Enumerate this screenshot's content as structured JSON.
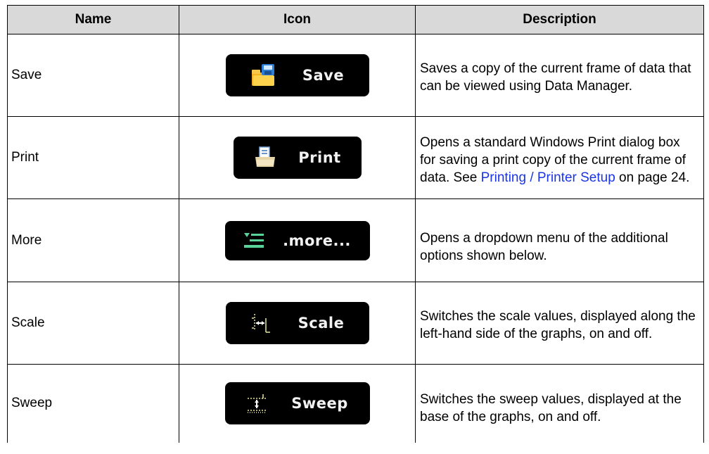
{
  "header": {
    "name": "Name",
    "icon": "Icon",
    "description": "Description"
  },
  "rows": [
    {
      "name": "Save",
      "button_label": "Save",
      "icon": "folder-disk-icon",
      "description": "Saves a copy of the current frame of data that can be viewed using Data Manager."
    },
    {
      "name": "Print",
      "button_label": "Print",
      "icon": "printer-icon",
      "description_pre": "Opens a standard Windows Print dialog box for saving a print copy of the current frame of data. See ",
      "description_link": "Printing / Printer Setup",
      "description_post": " on page 24."
    },
    {
      "name": "More",
      "button_label": ".more...",
      "icon": "list-menu-icon",
      "description": "Opens a dropdown menu of the additional options shown below."
    },
    {
      "name": "Scale",
      "button_label": "Scale",
      "icon": "scale-arrows-icon",
      "description": "Switches the scale values, displayed along the left-hand side of the graphs, on and off."
    },
    {
      "name": "Sweep",
      "button_label": "Sweep",
      "icon": "sweep-arrows-icon",
      "description": "Switches the sweep values, displayed at the base of the graphs, on and off."
    }
  ],
  "colors": {
    "header_bg": "#d9d9d9",
    "link": "#1a34e6",
    "button_bg": "#000000"
  }
}
